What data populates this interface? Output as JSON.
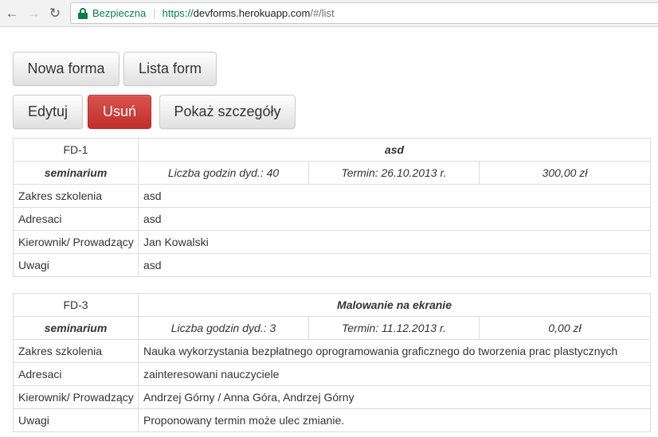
{
  "browser": {
    "back_icon": "←",
    "forward_icon": "→",
    "reload_icon": "↻",
    "secure_label": "Bezpieczna",
    "url_scheme": "https://",
    "url_host": "devforms.herokuapp.com",
    "url_path": "/#/list"
  },
  "toolbar": {
    "new_form_label": "Nowa forma",
    "form_list_label": "Lista form",
    "edit_label": "Edytuj",
    "delete_label": "Usuń",
    "details_label": "Pokaż szczegóły"
  },
  "colors": {
    "danger": "#d9534f",
    "secure_green": "#0b8043",
    "border": "#dddddd"
  },
  "forms": [
    {
      "id": "FD-1",
      "title": "asd",
      "type": "seminarium",
      "hours": "Liczba godzin dyd.: 40",
      "date": "Termin: 26.10.2013 r.",
      "price": "300,00 zł",
      "rows": [
        {
          "label": "Zakres szkolenia",
          "value": "asd"
        },
        {
          "label": "Adresaci",
          "value": "asd"
        },
        {
          "label": "Kierownik/ Prowadzący",
          "value": "Jan Kowalski"
        },
        {
          "label": "Uwagi",
          "value": "asd"
        }
      ]
    },
    {
      "id": "FD-3",
      "title": "Malowanie na ekranie",
      "type": "seminarium",
      "hours": "Liczba godzin dyd.: 3",
      "date": "Termin: 11.12.2013 r.",
      "price": "0,00 zł",
      "rows": [
        {
          "label": "Zakres szkolenia",
          "value": "Nauka wykorzystania bezpłatnego oprogramowania graficznego do tworzenia prac plastycznych"
        },
        {
          "label": "Adresaci",
          "value": "zainteresowani nauczyciele"
        },
        {
          "label": "Kierownik/ Prowadzący",
          "value": "Andrzej Górny / Anna Góra, Andrzej Górny"
        },
        {
          "label": "Uwagi",
          "value": "Proponowany termin może ulec zmianie."
        }
      ]
    }
  ]
}
